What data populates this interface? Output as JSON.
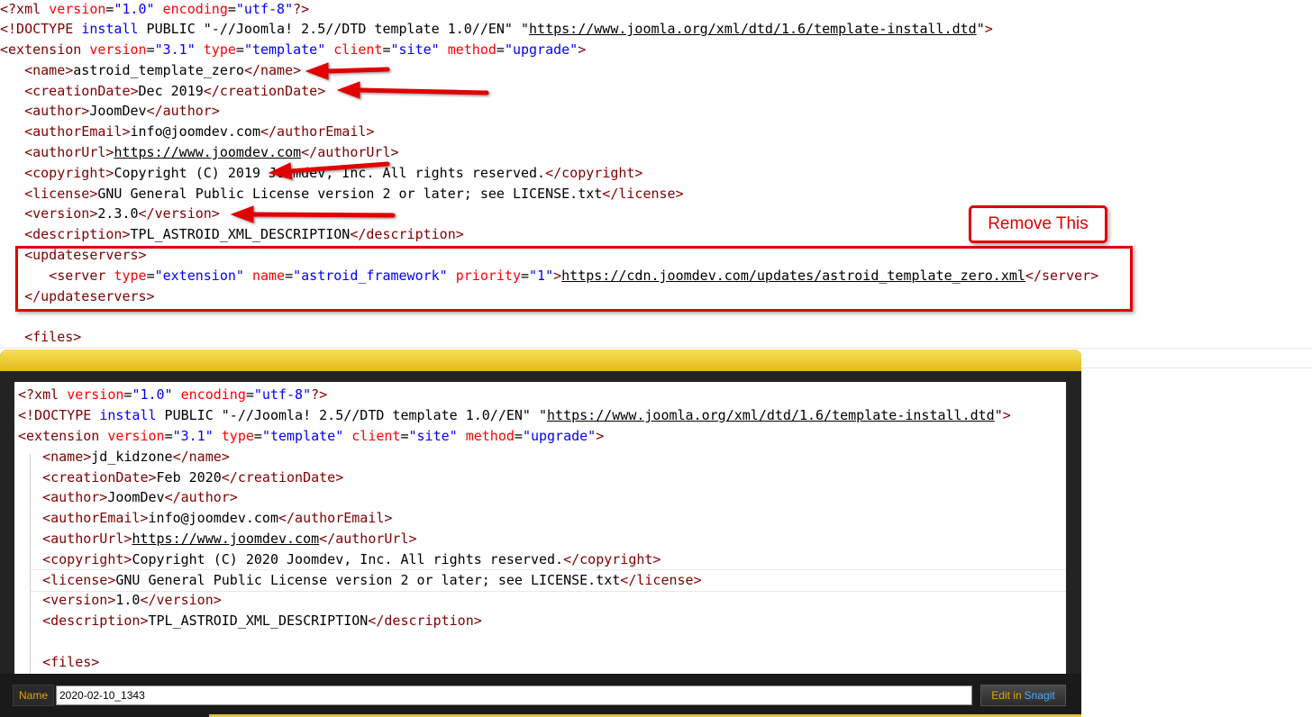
{
  "background_editor": {
    "lines": [
      {
        "segments": [
          {
            "c": "t",
            "s": "<?xml "
          },
          {
            "c": "a",
            "s": "version"
          },
          {
            "c": "x",
            "s": "="
          },
          {
            "c": "v",
            "s": "\"1.0\""
          },
          {
            "c": "x",
            "s": " "
          },
          {
            "c": "a",
            "s": "encoding"
          },
          {
            "c": "x",
            "s": "="
          },
          {
            "c": "v",
            "s": "\"utf-8\""
          },
          {
            "c": "t",
            "s": "?>"
          }
        ]
      },
      {
        "segments": [
          {
            "c": "t",
            "s": "<!DOCTYPE "
          },
          {
            "c": "v",
            "s": "install"
          },
          {
            "c": "x",
            "s": " PUBLIC \"-//Joomla! 2.5//DTD template 1.0//EN\" \""
          },
          {
            "c": "u",
            "s": "https://www.joomla.org/xml/dtd/1.6/template-install.dtd"
          },
          {
            "c": "x",
            "s": "\""
          },
          {
            "c": "t",
            "s": ">"
          }
        ]
      },
      {
        "segments": [
          {
            "c": "t",
            "s": "<extension "
          },
          {
            "c": "a",
            "s": "version"
          },
          {
            "c": "x",
            "s": "="
          },
          {
            "c": "v",
            "s": "\"3.1\""
          },
          {
            "c": "x",
            "s": " "
          },
          {
            "c": "a",
            "s": "type"
          },
          {
            "c": "x",
            "s": "="
          },
          {
            "c": "v",
            "s": "\"template\""
          },
          {
            "c": "x",
            "s": " "
          },
          {
            "c": "a",
            "s": "client"
          },
          {
            "c": "x",
            "s": "="
          },
          {
            "c": "v",
            "s": "\"site\""
          },
          {
            "c": "x",
            "s": " "
          },
          {
            "c": "a",
            "s": "method"
          },
          {
            "c": "x",
            "s": "="
          },
          {
            "c": "v",
            "s": "\"upgrade\""
          },
          {
            "c": "t",
            "s": ">"
          }
        ]
      },
      {
        "segments": [
          {
            "c": "x",
            "s": "   "
          },
          {
            "c": "t",
            "s": "<name>"
          },
          {
            "c": "x",
            "s": "astroid_template_zero"
          },
          {
            "c": "t",
            "s": "</name>"
          }
        ]
      },
      {
        "segments": [
          {
            "c": "x",
            "s": "   "
          },
          {
            "c": "t",
            "s": "<creationDate>"
          },
          {
            "c": "x",
            "s": "Dec 2019"
          },
          {
            "c": "t",
            "s": "</creationDate>"
          }
        ]
      },
      {
        "segments": [
          {
            "c": "x",
            "s": "   "
          },
          {
            "c": "t",
            "s": "<author>"
          },
          {
            "c": "x",
            "s": "JoomDev"
          },
          {
            "c": "t",
            "s": "</author>"
          }
        ]
      },
      {
        "segments": [
          {
            "c": "x",
            "s": "   "
          },
          {
            "c": "t",
            "s": "<authorEmail>"
          },
          {
            "c": "x",
            "s": "info@joomdev.com"
          },
          {
            "c": "t",
            "s": "</authorEmail>"
          }
        ]
      },
      {
        "segments": [
          {
            "c": "x",
            "s": "   "
          },
          {
            "c": "t",
            "s": "<authorUrl>"
          },
          {
            "c": "u",
            "s": "https://www.joomdev.com"
          },
          {
            "c": "t",
            "s": "</authorUrl>"
          }
        ]
      },
      {
        "segments": [
          {
            "c": "x",
            "s": "   "
          },
          {
            "c": "t",
            "s": "<copyright>"
          },
          {
            "c": "x",
            "s": "Copyright (C) 2019 Joomdev, Inc. All rights reserved."
          },
          {
            "c": "t",
            "s": "</copyright>"
          }
        ]
      },
      {
        "segments": [
          {
            "c": "x",
            "s": "   "
          },
          {
            "c": "t",
            "s": "<license>"
          },
          {
            "c": "x",
            "s": "GNU General Public License version 2 or later; see LICENSE.txt"
          },
          {
            "c": "t",
            "s": "</license>"
          }
        ]
      },
      {
        "segments": [
          {
            "c": "x",
            "s": "   "
          },
          {
            "c": "t",
            "s": "<version>"
          },
          {
            "c": "x",
            "s": "2.3.0"
          },
          {
            "c": "t",
            "s": "</version>"
          }
        ]
      },
      {
        "segments": [
          {
            "c": "x",
            "s": "   "
          },
          {
            "c": "t",
            "s": "<description>"
          },
          {
            "c": "x",
            "s": "TPL_ASTROID_XML_DESCRIPTION"
          },
          {
            "c": "t",
            "s": "</description>"
          }
        ]
      },
      {
        "segments": [
          {
            "c": "x",
            "s": "   "
          },
          {
            "c": "t",
            "s": "<updateservers>"
          }
        ]
      },
      {
        "segments": [
          {
            "c": "x",
            "s": "      "
          },
          {
            "c": "t",
            "s": "<server "
          },
          {
            "c": "a",
            "s": "type"
          },
          {
            "c": "x",
            "s": "="
          },
          {
            "c": "v",
            "s": "\"extension\""
          },
          {
            "c": "x",
            "s": " "
          },
          {
            "c": "a",
            "s": "name"
          },
          {
            "c": "x",
            "s": "="
          },
          {
            "c": "v",
            "s": "\"astroid_framework\""
          },
          {
            "c": "x",
            "s": " "
          },
          {
            "c": "a",
            "s": "priority"
          },
          {
            "c": "x",
            "s": "="
          },
          {
            "c": "v",
            "s": "\"1\""
          },
          {
            "c": "t",
            "s": ">"
          },
          {
            "c": "u",
            "s": "https://cdn.joomdev.com/updates/astroid_template_zero.xml"
          },
          {
            "c": "t",
            "s": "</server>"
          }
        ]
      },
      {
        "segments": [
          {
            "c": "x",
            "s": "   "
          },
          {
            "c": "t",
            "s": "</updateservers>"
          }
        ]
      },
      {
        "segments": [
          {
            "c": "x",
            "s": ""
          }
        ]
      },
      {
        "segments": [
          {
            "c": "x",
            "s": "   "
          },
          {
            "c": "t",
            "s": "<files>"
          }
        ]
      }
    ]
  },
  "annotation": {
    "callout_text": "Remove This",
    "color": "#e00000"
  },
  "snagit": {
    "lines": [
      {
        "segments": [
          {
            "c": "t",
            "s": "<?xml "
          },
          {
            "c": "a",
            "s": "version"
          },
          {
            "c": "x",
            "s": "="
          },
          {
            "c": "v",
            "s": "\"1.0\""
          },
          {
            "c": "x",
            "s": " "
          },
          {
            "c": "a",
            "s": "encoding"
          },
          {
            "c": "x",
            "s": "="
          },
          {
            "c": "v",
            "s": "\"utf-8\""
          },
          {
            "c": "t",
            "s": "?>"
          }
        ]
      },
      {
        "segments": [
          {
            "c": "t",
            "s": "<!DOCTYPE "
          },
          {
            "c": "v",
            "s": "install"
          },
          {
            "c": "x",
            "s": " PUBLIC \"-//Joomla! 2.5//DTD template 1.0//EN\" \""
          },
          {
            "c": "u",
            "s": "https://www.joomla.org/xml/dtd/1.6/template-install.dtd"
          },
          {
            "c": "x",
            "s": "\""
          },
          {
            "c": "t",
            "s": ">"
          }
        ]
      },
      {
        "segments": [
          {
            "c": "t",
            "s": "<extension "
          },
          {
            "c": "a",
            "s": "version"
          },
          {
            "c": "x",
            "s": "="
          },
          {
            "c": "v",
            "s": "\"3.1\""
          },
          {
            "c": "x",
            "s": " "
          },
          {
            "c": "a",
            "s": "type"
          },
          {
            "c": "x",
            "s": "="
          },
          {
            "c": "v",
            "s": "\"template\""
          },
          {
            "c": "x",
            "s": " "
          },
          {
            "c": "a",
            "s": "client"
          },
          {
            "c": "x",
            "s": "="
          },
          {
            "c": "v",
            "s": "\"site\""
          },
          {
            "c": "x",
            "s": " "
          },
          {
            "c": "a",
            "s": "method"
          },
          {
            "c": "x",
            "s": "="
          },
          {
            "c": "v",
            "s": "\"upgrade\""
          },
          {
            "c": "t",
            "s": ">"
          }
        ]
      },
      {
        "segments": [
          {
            "c": "x",
            "s": "   "
          },
          {
            "c": "t",
            "s": "<name>"
          },
          {
            "c": "x",
            "s": "jd_kidzone"
          },
          {
            "c": "t",
            "s": "</name>"
          }
        ]
      },
      {
        "segments": [
          {
            "c": "x",
            "s": "   "
          },
          {
            "c": "t",
            "s": "<creationDate>"
          },
          {
            "c": "x",
            "s": "Feb 2020"
          },
          {
            "c": "t",
            "s": "</creationDate>"
          }
        ]
      },
      {
        "segments": [
          {
            "c": "x",
            "s": "   "
          },
          {
            "c": "t",
            "s": "<author>"
          },
          {
            "c": "x",
            "s": "JoomDev"
          },
          {
            "c": "t",
            "s": "</author>"
          }
        ]
      },
      {
        "segments": [
          {
            "c": "x",
            "s": "   "
          },
          {
            "c": "t",
            "s": "<authorEmail>"
          },
          {
            "c": "x",
            "s": "info@joomdev.com"
          },
          {
            "c": "t",
            "s": "</authorEmail>"
          }
        ]
      },
      {
        "segments": [
          {
            "c": "x",
            "s": "   "
          },
          {
            "c": "t",
            "s": "<authorUrl>"
          },
          {
            "c": "u",
            "s": "https://www.joomdev.com"
          },
          {
            "c": "t",
            "s": "</authorUrl>"
          }
        ]
      },
      {
        "segments": [
          {
            "c": "x",
            "s": "   "
          },
          {
            "c": "t",
            "s": "<copyright>"
          },
          {
            "c": "x",
            "s": "Copyright (C) 2020 Joomdev, Inc. All rights reserved."
          },
          {
            "c": "t",
            "s": "</copyright>"
          }
        ]
      },
      {
        "segments": [
          {
            "c": "x",
            "s": "   "
          },
          {
            "c": "t",
            "s": "<license>"
          },
          {
            "c": "x",
            "s": "GNU General Public License version 2 or later; see LICENSE.txt"
          },
          {
            "c": "t",
            "s": "</license>"
          }
        ]
      },
      {
        "segments": [
          {
            "c": "x",
            "s": "   "
          },
          {
            "c": "t",
            "s": "<version>"
          },
          {
            "c": "x",
            "s": "1.0"
          },
          {
            "c": "t",
            "s": "</version>"
          }
        ]
      },
      {
        "segments": [
          {
            "c": "x",
            "s": "   "
          },
          {
            "c": "t",
            "s": "<description>"
          },
          {
            "c": "x",
            "s": "TPL_ASTROID_XML_DESCRIPTION"
          },
          {
            "c": "t",
            "s": "</description>"
          }
        ]
      },
      {
        "segments": [
          {
            "c": "x",
            "s": ""
          }
        ]
      },
      {
        "segments": [
          {
            "c": "x",
            "s": "   "
          },
          {
            "c": "t",
            "s": "<files>"
          }
        ]
      }
    ],
    "name_label": "Name",
    "name_value": "2020-02-10_1343",
    "edit_label": "Edit in",
    "edit_brand": "Snagit"
  },
  "colors": {
    "tag": "#800000",
    "attribute": "#ff0000",
    "value": "#0000ff",
    "snagit_frame": "#e2bb16",
    "snagit_accent": "#e6a400"
  }
}
